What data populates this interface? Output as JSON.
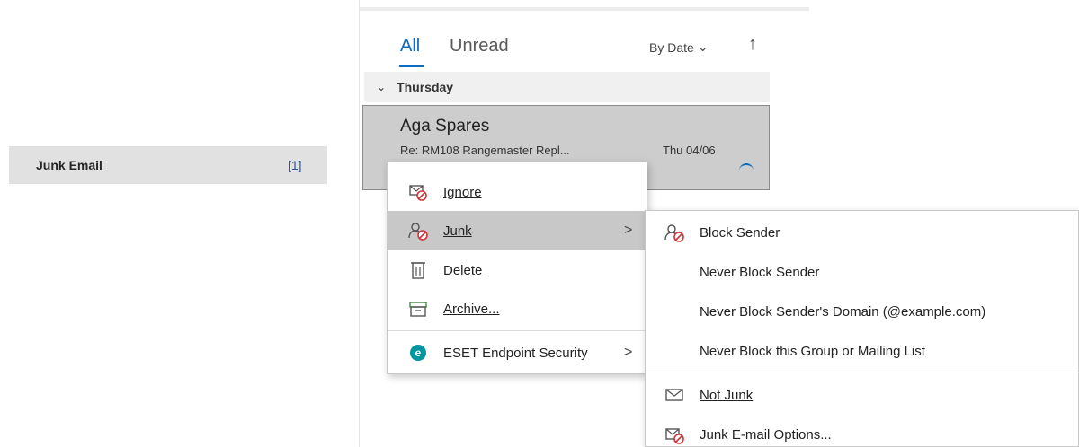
{
  "folder": {
    "name": "Junk Email",
    "count": "[1]"
  },
  "list": {
    "tabs": [
      "All",
      "Unread"
    ],
    "sort_label": "By Date",
    "sort_chevron": "⌄",
    "sort_direction": "↑",
    "group_chevron": "⌄",
    "group": "Thursday",
    "message": {
      "from": "Aga Spares",
      "subject": "Re: RM108 Rangemaster Repl...",
      "date": "Thu 04/06"
    }
  },
  "context_menu": {
    "items": [
      {
        "label": "Ignore",
        "icon": "ignore-icon"
      },
      {
        "label": "Junk",
        "icon": "junk-icon",
        "submenu_arrow": ">"
      },
      {
        "label": "Delete",
        "icon": "delete-icon"
      },
      {
        "label": "Archive...",
        "icon": "archive-icon"
      },
      {
        "label": "ESET Endpoint Security",
        "icon": "eset-icon",
        "submenu_arrow": ">"
      }
    ]
  },
  "junk_submenu": {
    "items": [
      {
        "label": "Block Sender",
        "icon": "block-sender-icon"
      },
      {
        "label": "Never Block Sender"
      },
      {
        "label": "Never Block Sender's Domain (@example.com)"
      },
      {
        "label": "Never Block this Group or Mailing List"
      },
      {
        "label": "Not Junk",
        "icon": "envelope-icon"
      },
      {
        "label": "Junk E-mail Options...",
        "icon": "junk-options-icon"
      }
    ]
  },
  "colors": {
    "accent": "#0f6cbd",
    "selection": "#cdcdcd",
    "hover": "#c8c8c8",
    "eset": "#0096a0"
  }
}
